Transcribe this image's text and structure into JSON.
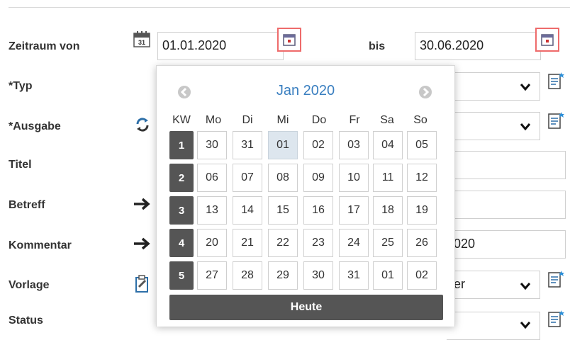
{
  "form": {
    "zeitraum_label": "Zeitraum von",
    "from_value": "01.01.2020",
    "bis_label": "bis",
    "to_value": "30.06.2020",
    "typ_label": "*Typ",
    "ausgabe_label": "*Ausgabe",
    "titel_label": "Titel",
    "betreff_label": "Betreff",
    "kommentar_label": "Kommentar",
    "kommentar_value_partial": "020",
    "vorlage_label": "Vorlage",
    "vorlage_value_partial": "er",
    "status_label": "Status"
  },
  "datepicker": {
    "month_label": "Jan 2020",
    "headers": [
      "KW",
      "Mo",
      "Di",
      "Mi",
      "Do",
      "Fr",
      "Sa",
      "So"
    ],
    "weeks": [
      {
        "kw": "1",
        "days": [
          "30",
          "31",
          "01",
          "02",
          "03",
          "04",
          "05"
        ]
      },
      {
        "kw": "2",
        "days": [
          "06",
          "07",
          "08",
          "09",
          "10",
          "11",
          "12"
        ]
      },
      {
        "kw": "3",
        "days": [
          "13",
          "14",
          "15",
          "16",
          "17",
          "18",
          "19"
        ]
      },
      {
        "kw": "4",
        "days": [
          "20",
          "21",
          "22",
          "23",
          "24",
          "25",
          "26"
        ]
      },
      {
        "kw": "5",
        "days": [
          "27",
          "28",
          "29",
          "30",
          "31",
          "01",
          "02"
        ]
      }
    ],
    "selected_day": "01",
    "today_button": "Heute"
  },
  "colors": {
    "highlight_border": "#ee6b6b",
    "month_text": "#3a7fc0",
    "kw_bg": "#555555",
    "selected_day_bg": "#dde6ee"
  }
}
